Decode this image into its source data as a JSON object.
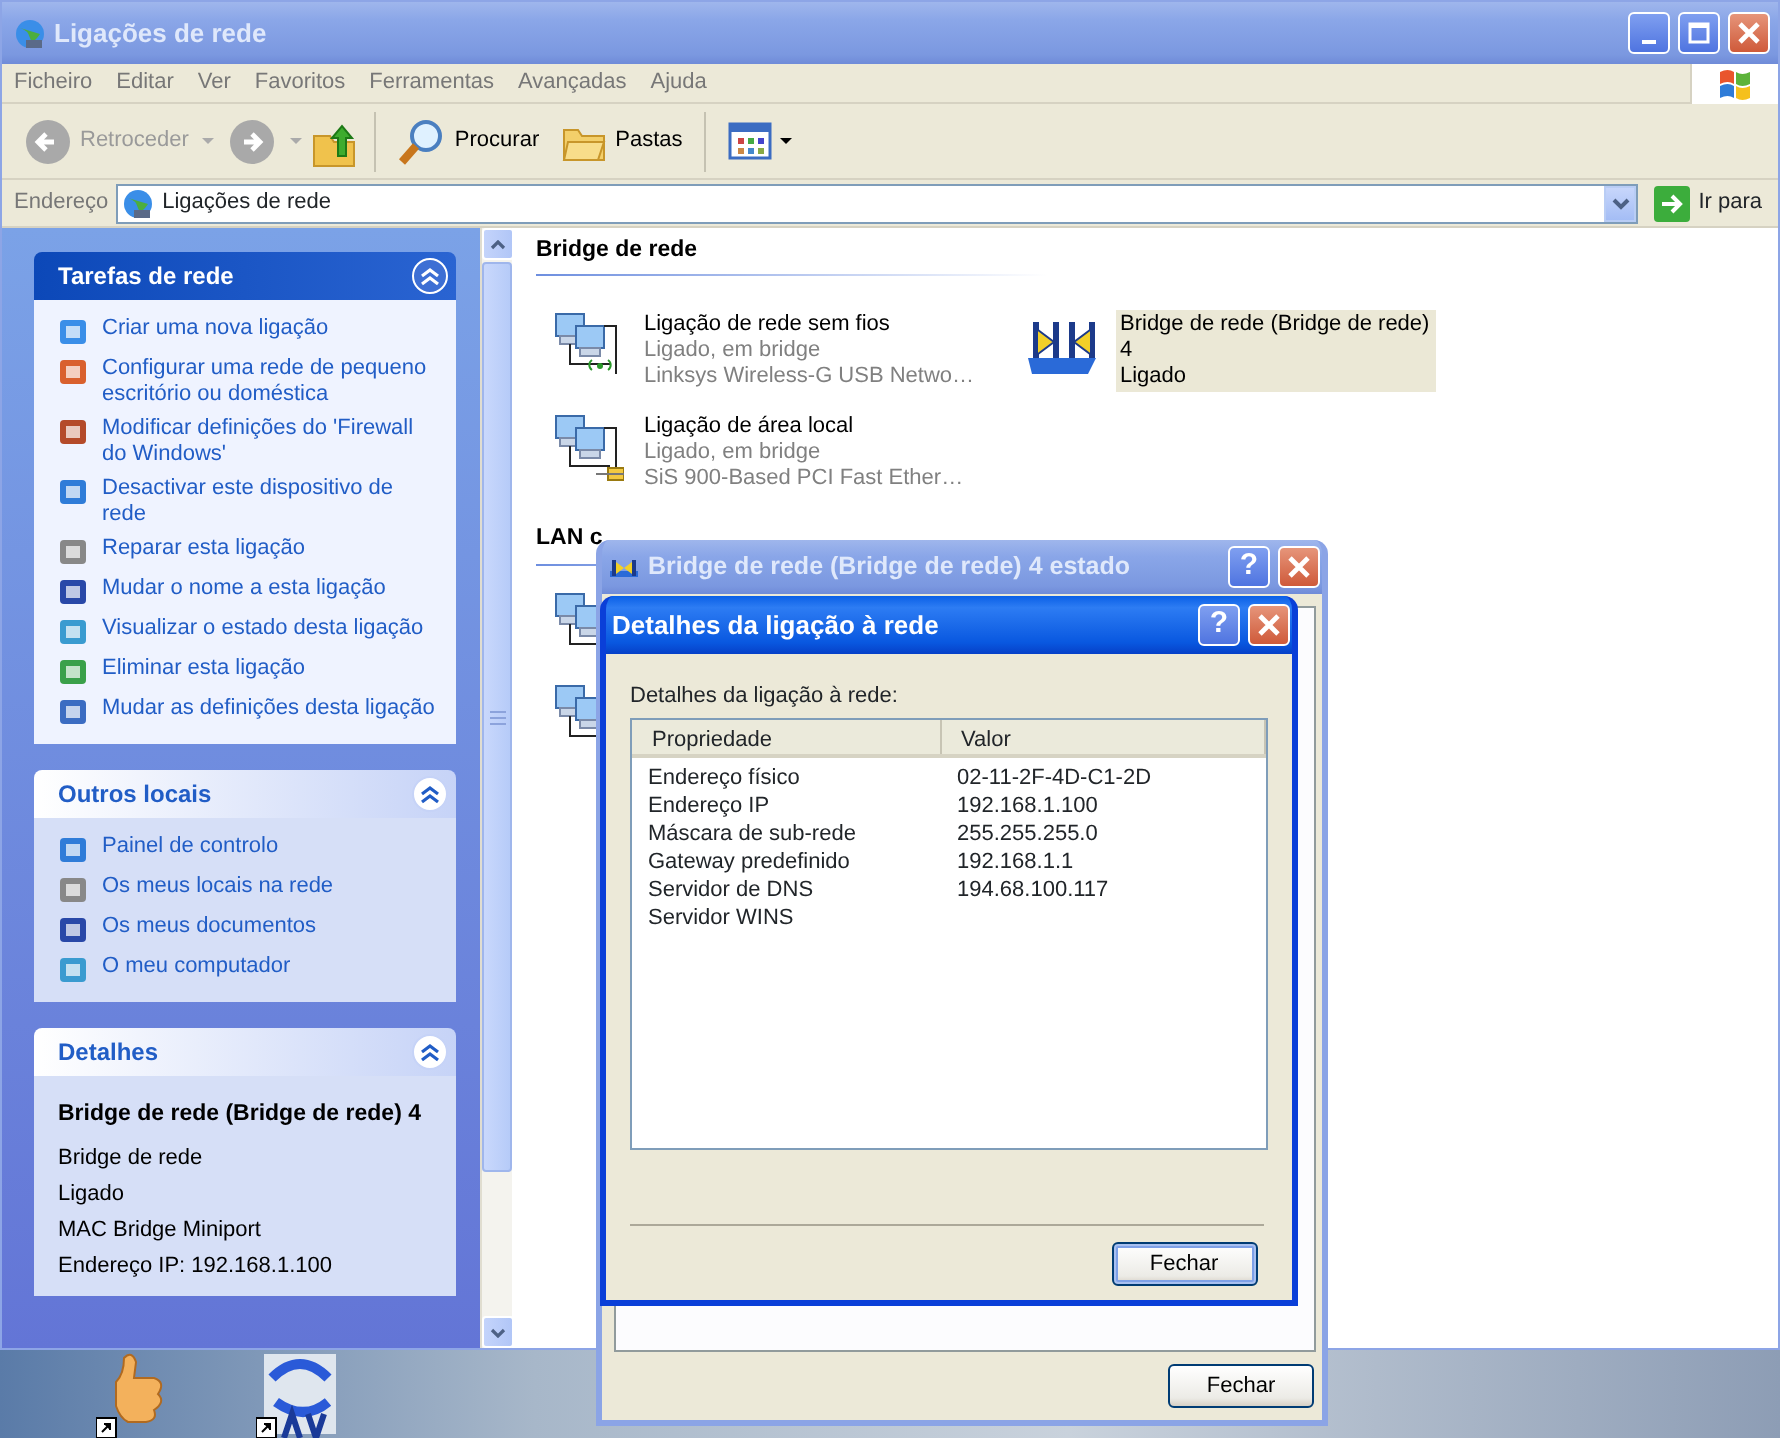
{
  "window": {
    "title": "Ligações de rede",
    "active": false
  },
  "menu": [
    {
      "label": "Ficheiro"
    },
    {
      "label": "Editar"
    },
    {
      "label": "Ver"
    },
    {
      "label": "Favoritos"
    },
    {
      "label": "Ferramentas"
    },
    {
      "label": "Avançadas"
    },
    {
      "label": "Ajuda"
    }
  ],
  "toolbar": {
    "back": {
      "label": "Retroceder",
      "disabled": true
    },
    "forward": {
      "disabled": true
    },
    "search": {
      "label": "Procurar"
    },
    "folders": {
      "label": "Pastas"
    }
  },
  "address": {
    "label": "Endereço",
    "value": "Ligações de rede",
    "go": "Ir para"
  },
  "sidebar": {
    "panels": [
      {
        "kind": "special",
        "title": "Tarefas de rede",
        "items": [
          {
            "label": "Criar uma nova ligação"
          },
          {
            "label": "Configurar uma rede de pequeno escritório ou doméstica"
          },
          {
            "label": "Modificar definições do 'Firewall do Windows'"
          },
          {
            "label": "Desactivar este dispositivo de rede"
          },
          {
            "label": "Reparar esta ligação"
          },
          {
            "label": "Mudar o nome a esta ligação"
          },
          {
            "label": "Visualizar o estado desta ligação"
          },
          {
            "label": "Eliminar esta ligação"
          },
          {
            "label": "Mudar as definições desta ligação"
          }
        ]
      },
      {
        "kind": "links",
        "title": "Outros locais",
        "items": [
          {
            "label": "Painel de controlo"
          },
          {
            "label": "Os meus locais na rede"
          },
          {
            "label": "Os meus documentos"
          },
          {
            "label": "O meu computador"
          }
        ]
      },
      {
        "kind": "details",
        "title": "Detalhes",
        "heading": "Bridge de rede (Bridge de rede) 4",
        "lines": [
          "Bridge de rede",
          "Ligado",
          "MAC Bridge Miniport",
          "Endereço IP: 192.168.1.100"
        ]
      }
    ]
  },
  "content": {
    "groups": [
      {
        "title": "Bridge de rede",
        "items": [
          {
            "kind": "wireless",
            "name": "Ligação de rede sem fios",
            "status": "Ligado, em bridge",
            "device": "Linksys Wireless-G USB Netwo…",
            "selected": false
          },
          {
            "kind": "bridge",
            "name": "Bridge de rede (Bridge de rede) 4",
            "status": "Ligado",
            "selected": true
          },
          {
            "kind": "lan",
            "name": "Ligação de área local",
            "status": "Ligado, em bridge",
            "device": "SiS 900-Based PCI Fast Ether…",
            "selected": false
          }
        ]
      },
      {
        "title": "LAN c",
        "items": [
          {
            "kind": "hidden"
          },
          {
            "kind": "hidden"
          }
        ]
      }
    ]
  },
  "dialogs": [
    {
      "title": "Bridge de rede (Bridge de rede) 4 estado",
      "active": false,
      "help": "?",
      "button": "Fechar"
    },
    {
      "title": "Detalhes da ligação à rede",
      "active": true,
      "help": "?",
      "label": "Detalhes da ligação à rede:",
      "columns": [
        "Propriedade",
        "Valor"
      ],
      "rows": [
        [
          "Endereço físico",
          "02-11-2F-4D-C1-2D"
        ],
        [
          "Endereço IP",
          "192.168.1.100"
        ],
        [
          "Máscara de sub-rede",
          "255.255.255.0"
        ],
        [
          "Gateway predefinido",
          "192.168.1.1"
        ],
        [
          "Servidor de DNS",
          "194.68.100.117"
        ],
        [
          "Servidor WINS",
          ""
        ]
      ],
      "button": "Fechar"
    }
  ]
}
